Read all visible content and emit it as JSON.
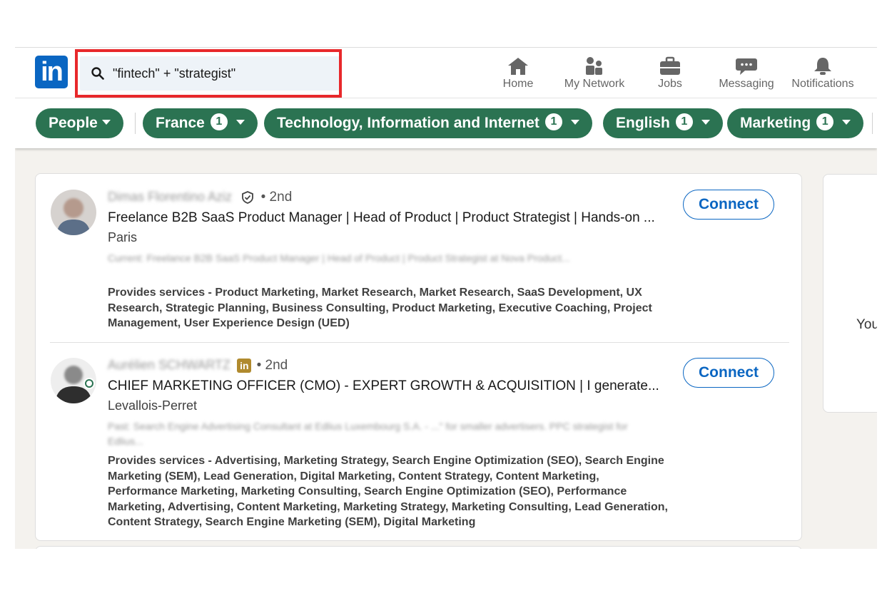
{
  "search": {
    "query": "\"fintech\" + \"strategist\""
  },
  "nav": {
    "home": "Home",
    "network": "My Network",
    "jobs": "Jobs",
    "messaging": "Messaging",
    "notifications": "Notifications"
  },
  "filters": [
    {
      "label": "People"
    },
    {
      "label": "France",
      "count": "1"
    },
    {
      "label": "Technology, Information and Internet",
      "count": "1"
    },
    {
      "label": "English",
      "count": "1"
    },
    {
      "label": "Marketing",
      "count": "1"
    }
  ],
  "results": [
    {
      "name": "Dimas Florentino Aziz",
      "degree": "• 2nd",
      "headline": "Freelance B2B SaaS Product Manager | Head of Product | Product Strategist | Hands-on ...",
      "location": "Paris",
      "snippet": "Current: Freelance B2B SaaS Product Manager | Head of Product | Product Strategist at Nova Product...",
      "services": "Provides services - Product Marketing, Market Research, Market Research, SaaS Development, UX Research, Strategic Planning, Business Consulting, Product Marketing, Executive Coaching, Project Management, User Experience Design (UED)",
      "action": "Connect"
    },
    {
      "name": "Aurélien SCHWARTZ",
      "degree": "• 2nd",
      "headline": "CHIEF MARKETING OFFICER (CMO) - EXPERT GROWTH & ACQUISITION | I generate...",
      "location": "Levallois-Perret",
      "snippet": "Past: Search Engine Advertising Consultant at Edlius Luxembourg S.A. - ...\" for smaller advertisers. PPC strategist for Edlius...",
      "services": "Provides services - Advertising, Marketing Strategy, Search Engine Optimization (SEO), Search Engine Marketing (SEM), Lead Generation, Digital Marketing, Content Strategy, Content Marketing, Performance Marketing, Marketing Consulting, Search Engine Optimization (SEO), Performance Marketing, Advertising, Content Marketing, Marketing Strategy, Marketing Consulting, Lead Generation, Content Strategy, Search Engine Marketing (SEM), Digital Marketing",
      "action": "Connect"
    }
  ],
  "side": {
    "text": "You"
  },
  "icons": {
    "logo": "linkedin-logo",
    "search": "search-icon",
    "home": "home-icon",
    "network": "people-icon",
    "jobs": "briefcase-icon",
    "messaging": "chat-icon",
    "notifications": "bell-icon",
    "verified": "shield-check-icon",
    "premium": "linkedin-premium-icon"
  },
  "logo_text": "in",
  "colors": {
    "brand": "#0a66c2",
    "filter_pill": "#2b7352",
    "highlight": "#e8282b"
  }
}
